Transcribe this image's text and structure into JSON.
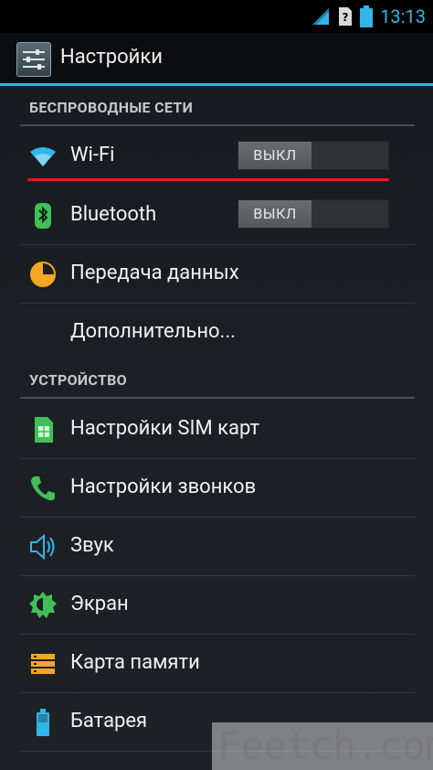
{
  "status": {
    "time": "13:13"
  },
  "header": {
    "title": "Настройки"
  },
  "sections": {
    "wireless": "БЕСПРОВОДНЫЕ СЕТИ",
    "device": "УСТРОЙСТВО"
  },
  "items": {
    "wifi": {
      "label": "Wi-Fi",
      "toggle": "ВЫКЛ"
    },
    "bluetooth": {
      "label": "Bluetooth",
      "toggle": "ВЫКЛ"
    },
    "data": {
      "label": "Передача данных"
    },
    "more": {
      "label": "Дополнительно..."
    },
    "sim": {
      "label": "Настройки SIM карт"
    },
    "calls": {
      "label": "Настройки звонков"
    },
    "sound": {
      "label": "Звук"
    },
    "display": {
      "label": "Экран"
    },
    "storage": {
      "label": "Карта памяти"
    },
    "battery": {
      "label": "Батарея"
    }
  },
  "watermark": "Feetch.com",
  "colors": {
    "accent": "#33b5e5",
    "highlight": "#e21d1d"
  }
}
